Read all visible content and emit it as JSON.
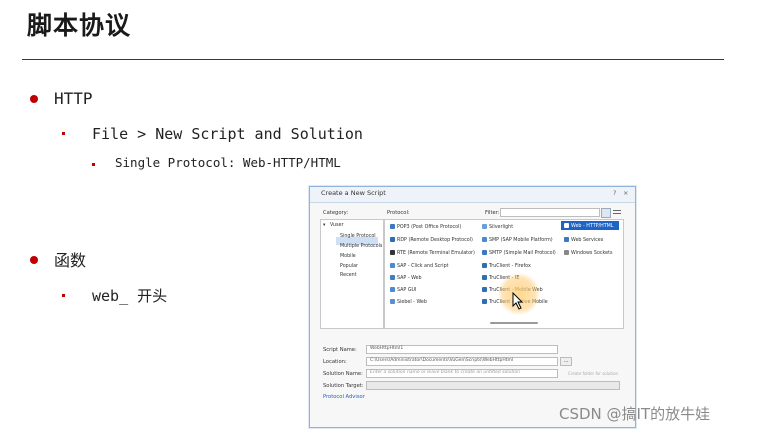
{
  "slide": {
    "title": "脚本协议",
    "bullets": {
      "http": "HTTP",
      "path": "File > New Script and Solution",
      "single": "Single Protocol: Web-HTTP/HTML",
      "funcs": "函数",
      "web": "web_ 开头"
    }
  },
  "dialog": {
    "title": "Create a New Script",
    "help": "?",
    "close": "×",
    "category_label": "Category:",
    "protocol_label": "Protocol:",
    "filter_label": "Filter:",
    "filter_value": "",
    "categories": [
      "Vuser",
      "Single Protocol",
      "Multiple Protocols",
      "Mobile",
      "Popular",
      "Recent"
    ],
    "protocols_col1": [
      "POP3 (Post Office Protocol)",
      "RDP (Remote Desktop Protocol)",
      "RTE (Remote Terminal Emulator)",
      "SAP - Click and Script",
      "SAP - Web",
      "SAP GUI",
      "Siebel - Web"
    ],
    "protocols_col2": [
      "Silverlight",
      "SMP (SAP Mobile Platform)",
      "SMTP (Simple Mail Protocol)",
      "TruClient - Firefox",
      "TruClient - IE",
      "TruClient - Mobile Web",
      "TruClient - Native Mobile"
    ],
    "protocols_col3": [
      "Web - HTTP/HTML",
      "Web Services",
      "Windows Sockets"
    ],
    "script_name_label": "Script Name:",
    "script_name_value": "WebHttpHtml1",
    "location_label": "Location:",
    "location_value": "C:\\Users\\Administrator\\Documents\\VuGen\\Scripts\\WebHttpHtml",
    "browse_label": "...",
    "solution_name_label": "Solution Name:",
    "solution_name_placeholder": "Enter a solution name or leave blank to create an untitled solution",
    "create_folder_label": "Create folder for solution",
    "solution_target_label": "Solution Target:",
    "protocol_advisor_label": "Protocol Advisor",
    "create_button": "Create",
    "cancel_button": "Cancel"
  },
  "watermark": "CSDN @搞IT的放牛娃"
}
